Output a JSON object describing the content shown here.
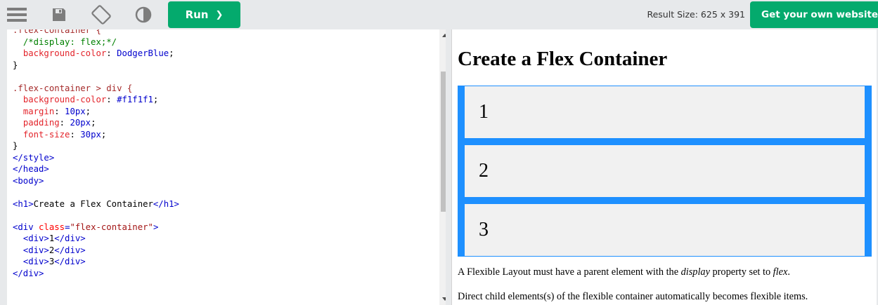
{
  "toolbar": {
    "icons": [
      "menu-icon",
      "save-icon",
      "rotate-icon",
      "theme-icon"
    ],
    "run_label": "Run",
    "run_chevron": "❯",
    "result_size": "Result Size: 625 x 391",
    "get_own_label": "Get your own website"
  },
  "code": {
    "lines": [
      [
        {
          "c": "c-sel",
          "t": ".flex-container {"
        }
      ],
      [
        {
          "c": "",
          "t": "  "
        },
        {
          "c": "c-com",
          "t": "/*display: flex;*/"
        }
      ],
      [
        {
          "c": "",
          "t": "  "
        },
        {
          "c": "c-prop",
          "t": "background-color"
        },
        {
          "c": "",
          "t": ": "
        },
        {
          "c": "c-val",
          "t": "DodgerBlue"
        },
        {
          "c": "",
          "t": ";"
        }
      ],
      [
        {
          "c": "",
          "t": "}"
        }
      ],
      [
        {
          "c": "",
          "t": ""
        }
      ],
      [
        {
          "c": "c-sel",
          "t": ".flex-container > div {"
        }
      ],
      [
        {
          "c": "",
          "t": "  "
        },
        {
          "c": "c-prop",
          "t": "background-color"
        },
        {
          "c": "",
          "t": ": "
        },
        {
          "c": "c-val",
          "t": "#f1f1f1"
        },
        {
          "c": "",
          "t": ";"
        }
      ],
      [
        {
          "c": "",
          "t": "  "
        },
        {
          "c": "c-prop",
          "t": "margin"
        },
        {
          "c": "",
          "t": ": "
        },
        {
          "c": "c-val",
          "t": "10px"
        },
        {
          "c": "",
          "t": ";"
        }
      ],
      [
        {
          "c": "",
          "t": "  "
        },
        {
          "c": "c-prop",
          "t": "padding"
        },
        {
          "c": "",
          "t": ": "
        },
        {
          "c": "c-val",
          "t": "20px"
        },
        {
          "c": "",
          "t": ";"
        }
      ],
      [
        {
          "c": "",
          "t": "  "
        },
        {
          "c": "c-prop",
          "t": "font-size"
        },
        {
          "c": "",
          "t": ": "
        },
        {
          "c": "c-val",
          "t": "30px"
        },
        {
          "c": "",
          "t": ";"
        }
      ],
      [
        {
          "c": "",
          "t": "}"
        }
      ],
      [
        {
          "c": "c-tag",
          "t": "</style>"
        }
      ],
      [
        {
          "c": "c-tag",
          "t": "</head>"
        }
      ],
      [
        {
          "c": "c-tag",
          "t": "<body>"
        }
      ],
      [
        {
          "c": "",
          "t": ""
        }
      ],
      [
        {
          "c": "c-tag",
          "t": "<h1>"
        },
        {
          "c": "",
          "t": "Create a Flex Container"
        },
        {
          "c": "c-tag",
          "t": "</h1>"
        }
      ],
      [
        {
          "c": "",
          "t": ""
        }
      ],
      [
        {
          "c": "c-tag",
          "t": "<div "
        },
        {
          "c": "c-attr",
          "t": "class"
        },
        {
          "c": "c-tag",
          "t": "="
        },
        {
          "c": "c-str",
          "t": "\"flex-container\""
        },
        {
          "c": "c-tag",
          "t": ">"
        }
      ],
      [
        {
          "c": "",
          "t": "  "
        },
        {
          "c": "c-tag",
          "t": "<div>"
        },
        {
          "c": "",
          "t": "1"
        },
        {
          "c": "c-tag",
          "t": "</div>"
        }
      ],
      [
        {
          "c": "",
          "t": "  "
        },
        {
          "c": "c-tag",
          "t": "<div>"
        },
        {
          "c": "",
          "t": "2"
        },
        {
          "c": "c-tag",
          "t": "</div>"
        }
      ],
      [
        {
          "c": "",
          "t": "  "
        },
        {
          "c": "c-tag",
          "t": "<div>"
        },
        {
          "c": "",
          "t": "3"
        },
        {
          "c": "c-tag",
          "t": "</div>"
        }
      ],
      [
        {
          "c": "c-tag",
          "t": "</div>"
        }
      ]
    ]
  },
  "result": {
    "heading": "Create a Flex Container",
    "items": [
      "1",
      "2",
      "3"
    ],
    "p1_a": "A Flexible Layout must have a parent element with the ",
    "p1_em1": "display",
    "p1_b": " property set to ",
    "p1_em2": "flex",
    "p1_c": ".",
    "p2": "Direct child elements(s) of the flexible container automatically becomes flexible items."
  },
  "colors": {
    "accent_green": "#04aa6d",
    "dodger_blue": "#1e90ff",
    "item_bg": "#f1f1f1"
  }
}
